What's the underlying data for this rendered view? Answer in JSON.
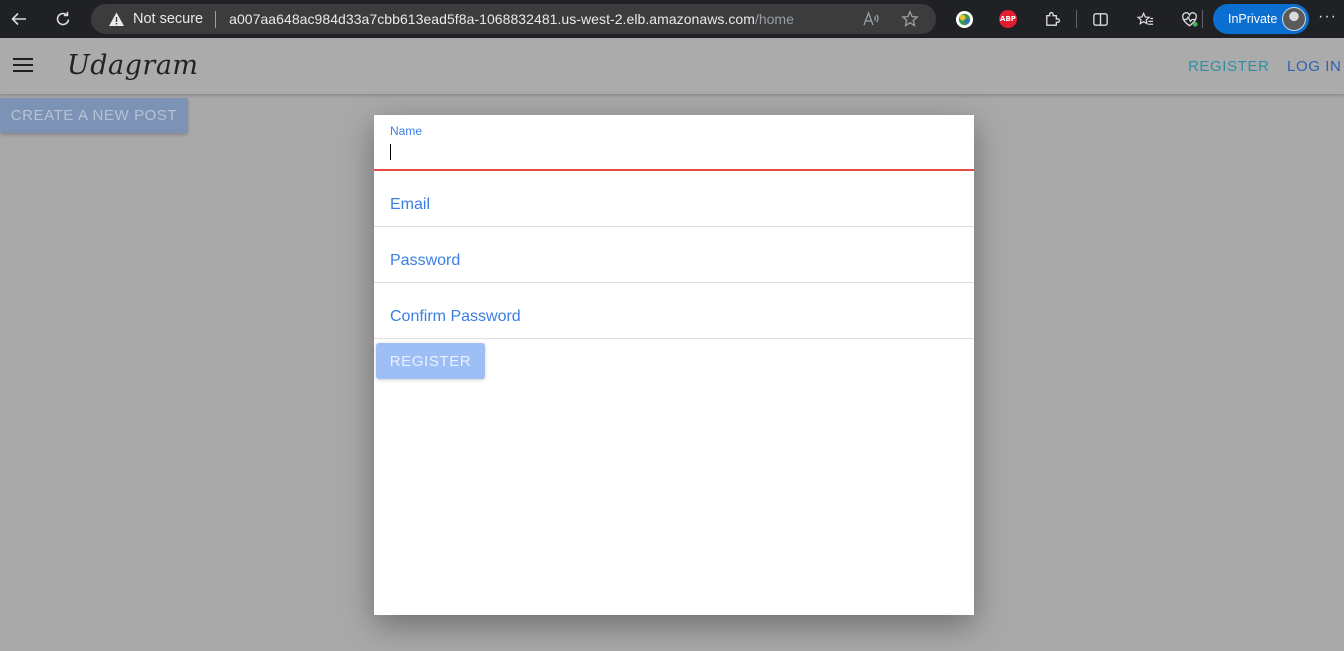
{
  "browser": {
    "security_label": "Not secure",
    "url_host": "a007aa648ac984d33a7cbb613ead5f8a-1068832481.us-west-2.elb.amazonaws.com",
    "url_path": "/home",
    "profile_label": "InPrivate",
    "abp_label": "ABP",
    "more_label": "···"
  },
  "app": {
    "brand": "Udagram",
    "nav": {
      "register": "REGISTER",
      "login": "LOG IN"
    },
    "create_post_label": "CREATE A NEW POST"
  },
  "register_form": {
    "name": {
      "label": "Name",
      "value": ""
    },
    "email": {
      "placeholder": "Email"
    },
    "password": {
      "placeholder": "Password"
    },
    "confirm_password": {
      "placeholder": "Confirm Password"
    },
    "submit_label": "REGISTER"
  },
  "colors": {
    "accent_blue": "#3a7ee6",
    "nav_teal": "#2f8fa3",
    "nav_blue": "#2e62b5",
    "error_red": "#e54d42",
    "disabled_button": "#9dbff5"
  }
}
